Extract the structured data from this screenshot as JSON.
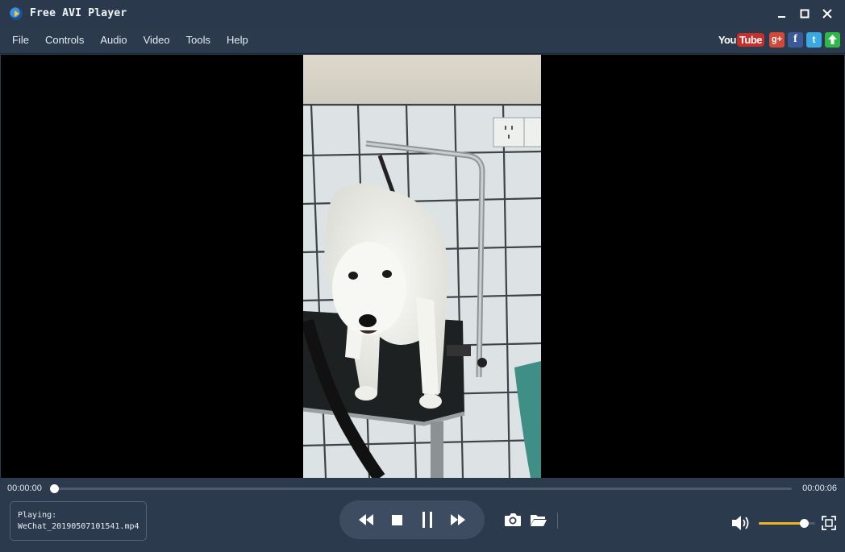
{
  "window": {
    "title": "Free AVI Player",
    "minimize_icon": "minimize-icon",
    "maximize_icon": "maximize-icon",
    "close_icon": "close-icon"
  },
  "menu": {
    "items": [
      "File",
      "Controls",
      "Audio",
      "Video",
      "Tools",
      "Help"
    ]
  },
  "social": {
    "youtube_you": "You",
    "youtube_tube": "Tube",
    "googleplus": "g+",
    "facebook": "f",
    "twitter": "t",
    "upload_icon": "upload-arrow-icon"
  },
  "playback": {
    "current_time": "00:00:00",
    "total_time": "00:00:06",
    "progress": 0.0,
    "status_label": "Playing:",
    "file_name": "WeChat_20190507101541.mp4",
    "volume": 0.8
  },
  "colors": {
    "background": "#2c3a4d",
    "accent_volume": "#f0b429",
    "youtube_red": "#c4302b"
  }
}
